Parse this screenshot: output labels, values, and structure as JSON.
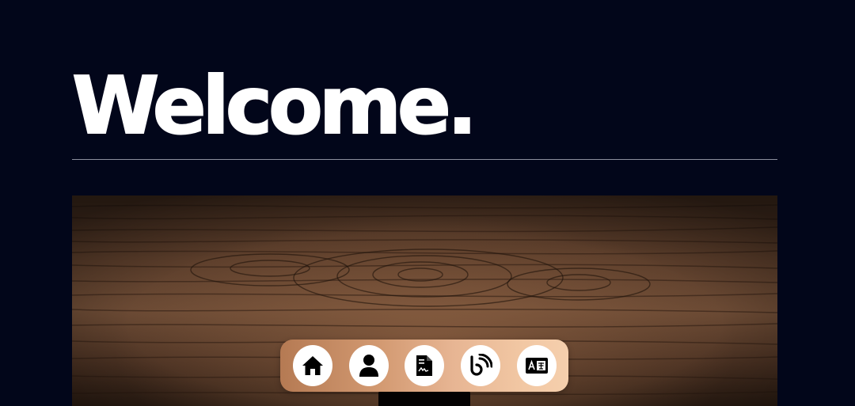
{
  "header": {
    "title": "Welcome."
  },
  "colors": {
    "background": "#02061a",
    "title": "#ffffff",
    "divider": "#8c8f9e",
    "dock_start": "#b57a53",
    "dock_end": "#f5cfad",
    "button_bg": "#ffffff",
    "icon": "#000000"
  },
  "hero": {
    "image": "wood-texture"
  },
  "dock": {
    "items": [
      {
        "icon": "home-icon"
      },
      {
        "icon": "person-icon"
      },
      {
        "icon": "resume-document-icon"
      },
      {
        "icon": "blog-feed-icon"
      },
      {
        "icon": "contact-card-icon"
      }
    ]
  }
}
